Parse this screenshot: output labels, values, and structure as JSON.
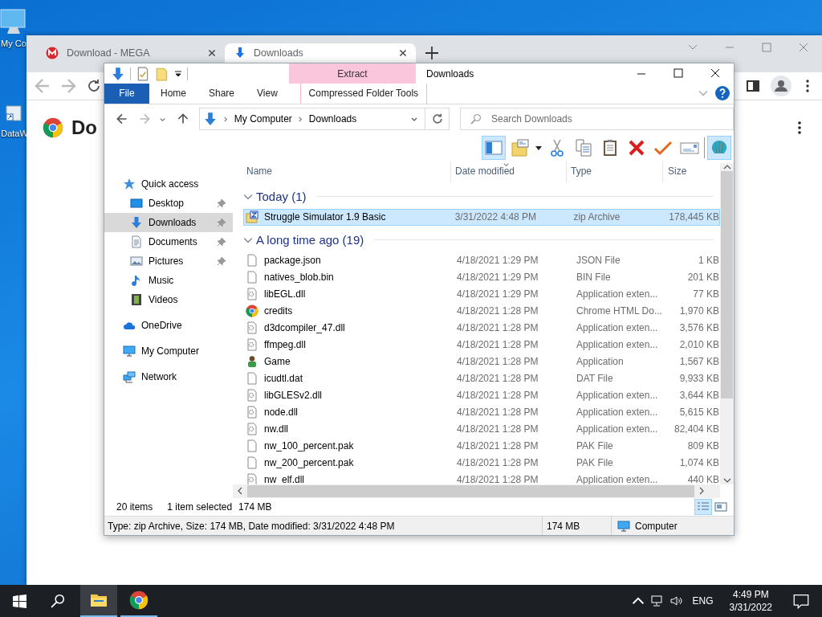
{
  "desktop": {
    "icons": [
      {
        "label": "My Co",
        "kind": "computer"
      },
      {
        "label": "DataW",
        "kind": "shortcut"
      }
    ]
  },
  "browser": {
    "tabs": [
      {
        "title": "Download - MEGA",
        "selected": false
      },
      {
        "title": "Downloads",
        "selected": true
      }
    ],
    "page_heading": "Do"
  },
  "explorer": {
    "title": "Downloads",
    "context_tab": "Extract",
    "ribbon_tabs": [
      {
        "label": "File",
        "selected": true
      },
      {
        "label": "Home",
        "selected": false
      },
      {
        "label": "Share",
        "selected": false
      },
      {
        "label": "View",
        "selected": false
      },
      {
        "label": "Compressed Folder Tools",
        "selected": false
      }
    ],
    "path": [
      "My Computer",
      "Downloads"
    ],
    "search": {
      "placeholder": "Search Downloads"
    },
    "toolbar": [
      {
        "kind": "pane",
        "on": true
      },
      {
        "kind": "folder-card",
        "on": false
      },
      {
        "kind": "cut",
        "on": false
      },
      {
        "kind": "copy",
        "on": false
      },
      {
        "kind": "paste",
        "on": false
      },
      {
        "kind": "delete",
        "on": false
      },
      {
        "kind": "check",
        "on": false
      },
      {
        "kind": "card",
        "on": false
      },
      {
        "kind": "shell",
        "on": true
      }
    ],
    "nav": [
      {
        "label": "Quick access",
        "kind": "star",
        "selected": false,
        "children": [
          {
            "label": "Desktop",
            "kind": "desktop",
            "selected": false,
            "pinned": true
          },
          {
            "label": "Downloads",
            "kind": "download",
            "selected": true,
            "pinned": true
          },
          {
            "label": "Documents",
            "kind": "documents",
            "selected": false,
            "pinned": true
          },
          {
            "label": "Pictures",
            "kind": "pictures",
            "selected": false,
            "pinned": true
          },
          {
            "label": "Music",
            "kind": "music",
            "selected": false,
            "pinned": false
          },
          {
            "label": "Videos",
            "kind": "videos",
            "selected": false,
            "pinned": false
          }
        ]
      },
      {
        "label": "OneDrive",
        "kind": "cloud",
        "selected": false
      },
      {
        "label": "My Computer",
        "kind": "computer",
        "selected": false
      },
      {
        "label": "Network",
        "kind": "network",
        "selected": false
      }
    ],
    "columns": [
      "Name",
      "Date modified",
      "Type",
      "Size"
    ],
    "groups": [
      {
        "label": "Today (1)",
        "expanded": true,
        "rows": [
          {
            "name": "Struggle Simulator 1.9 Basic",
            "date": "3/31/2022 4:48 PM",
            "type": "zip Archive",
            "size": "178,445 KB",
            "kind": "zip",
            "selected": true
          }
        ]
      },
      {
        "label": "A long time ago (19)",
        "expanded": true,
        "rows": [
          {
            "name": "package.json",
            "date": "4/18/2021 1:29 PM",
            "type": "JSON File",
            "size": "1 KB",
            "kind": "blank",
            "selected": false
          },
          {
            "name": "natives_blob.bin",
            "date": "4/18/2021 1:29 PM",
            "type": "BIN File",
            "size": "201 KB",
            "kind": "blank",
            "selected": false
          },
          {
            "name": "libEGL.dll",
            "date": "4/18/2021 1:29 PM",
            "type": "Application exten...",
            "size": "77 KB",
            "kind": "dll",
            "selected": false
          },
          {
            "name": "credits",
            "date": "4/18/2021 1:28 PM",
            "type": "Chrome HTML Do...",
            "size": "1,970 KB",
            "kind": "chrome",
            "selected": false
          },
          {
            "name": "d3dcompiler_47.dll",
            "date": "4/18/2021 1:28 PM",
            "type": "Application exten...",
            "size": "3,576 KB",
            "kind": "dll",
            "selected": false
          },
          {
            "name": "ffmpeg.dll",
            "date": "4/18/2021 1:28 PM",
            "type": "Application exten...",
            "size": "2,010 KB",
            "kind": "dll",
            "selected": false
          },
          {
            "name": "Game",
            "date": "4/18/2021 1:28 PM",
            "type": "Application",
            "size": "1,567 KB",
            "kind": "game",
            "selected": false
          },
          {
            "name": "icudtl.dat",
            "date": "4/18/2021 1:28 PM",
            "type": "DAT File",
            "size": "9,933 KB",
            "kind": "blank",
            "selected": false
          },
          {
            "name": "libGLESv2.dll",
            "date": "4/18/2021 1:28 PM",
            "type": "Application exten...",
            "size": "3,644 KB",
            "kind": "dll",
            "selected": false
          },
          {
            "name": "node.dll",
            "date": "4/18/2021 1:28 PM",
            "type": "Application exten...",
            "size": "5,615 KB",
            "kind": "dll",
            "selected": false
          },
          {
            "name": "nw.dll",
            "date": "4/18/2021 1:28 PM",
            "type": "Application exten...",
            "size": "82,404 KB",
            "kind": "dll",
            "selected": false
          },
          {
            "name": "nw_100_percent.pak",
            "date": "4/18/2021 1:28 PM",
            "type": "PAK File",
            "size": "809 KB",
            "kind": "blank",
            "selected": false
          },
          {
            "name": "nw_200_percent.pak",
            "date": "4/18/2021 1:28 PM",
            "type": "PAK File",
            "size": "1,074 KB",
            "kind": "blank",
            "selected": false
          },
          {
            "name": "nw_elf.dll",
            "date": "4/18/2021 1:28 PM",
            "type": "Application exten...",
            "size": "440 KB",
            "kind": "dll",
            "selected": false
          }
        ]
      }
    ],
    "status": {
      "items": "20 items",
      "selection": "1 item selected",
      "selection_size": "174 MB"
    },
    "view_buttons": [
      {
        "kind": "details",
        "selected": true
      },
      {
        "kind": "tiles",
        "selected": false
      }
    ],
    "details_bar": {
      "info": "Type: zip Archive, Size: 174 MB, Date modified: 3/31/2022 4:48 PM",
      "size": "174 MB",
      "location": "Computer"
    }
  },
  "taskbar": {
    "apps": [
      {
        "kind": "explorer",
        "selected": true
      },
      {
        "kind": "browser",
        "selected": false
      }
    ],
    "language": "ENG",
    "time": "4:49 PM",
    "date": "3/31/2022"
  }
}
